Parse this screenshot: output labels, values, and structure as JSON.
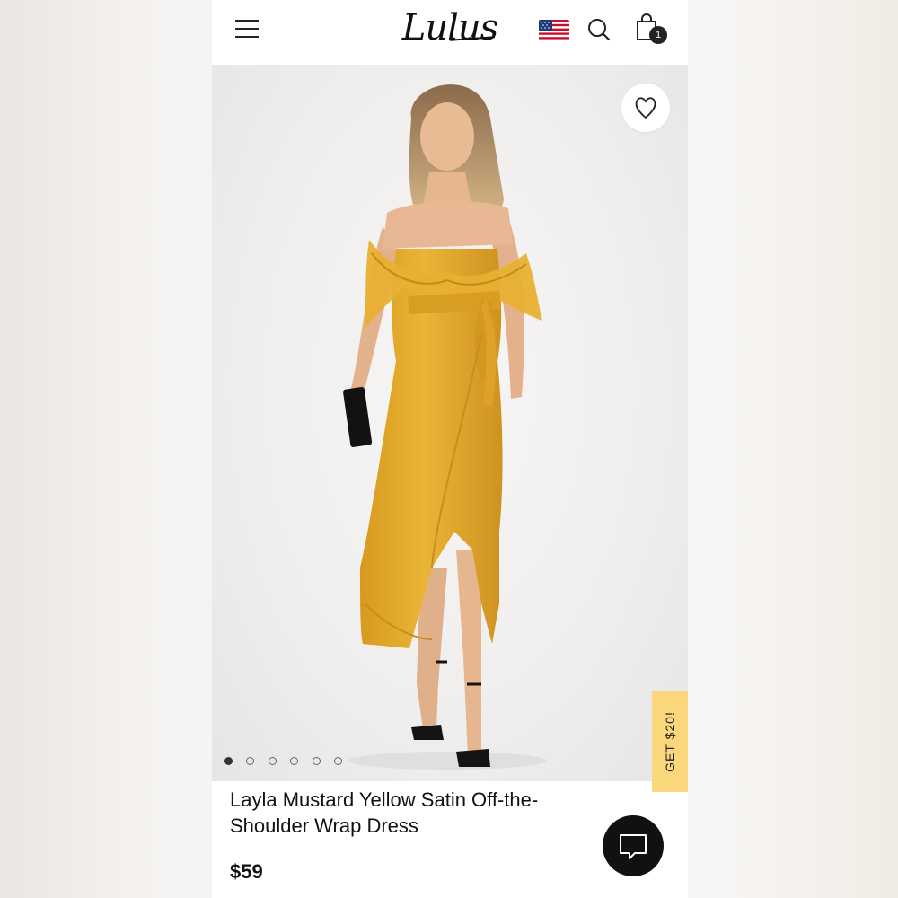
{
  "header": {
    "logo_text": "Lulus",
    "cart_count": "1",
    "icons": [
      "hamburger-menu-icon",
      "us-flag-icon",
      "search-icon",
      "shopping-bag-icon"
    ]
  },
  "product": {
    "title": "Layla Mustard Yellow Satin Off-the-Shoulder Wrap Dress",
    "price": "$59",
    "image_count": 6,
    "active_image": 1,
    "image_alt": "Model wearing mustard yellow satin wrap dress"
  },
  "promo": {
    "label": "GET $20!"
  },
  "colors": {
    "dress": "#e2a92c",
    "promo_bg": "#f9d77a",
    "chat_bg": "#111111"
  },
  "icons": {
    "favorite": "heart-icon",
    "chat": "chat-bubble-icon"
  }
}
